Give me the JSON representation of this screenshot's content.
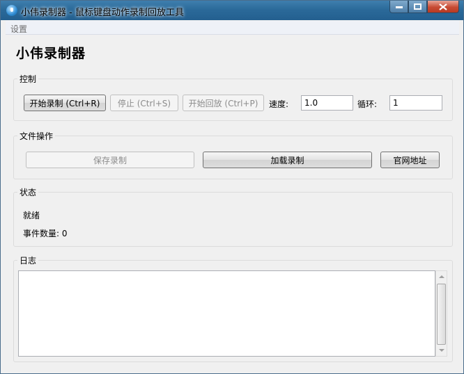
{
  "window": {
    "title": "小伟录制器 - 鼠标键盘动作录制回放工具"
  },
  "menu": {
    "items": [
      "设置"
    ]
  },
  "main": {
    "title": "小伟录制器"
  },
  "control": {
    "group_label": "控制",
    "start_record_label": "开始录制 (Ctrl+R)",
    "stop_label": "停止 (Ctrl+S)",
    "start_playback_label": "开始回放 (Ctrl+P)",
    "speed_label": "速度:",
    "speed_value": "1.0",
    "loop_label": "循环:",
    "loop_value": "1"
  },
  "file_ops": {
    "group_label": "文件操作",
    "save_label": "保存录制",
    "load_label": "加载录制",
    "website_label": "官网地址"
  },
  "status": {
    "group_label": "状态",
    "state_text": "就绪",
    "event_count_text": "事件数量: 0"
  },
  "log": {
    "group_label": "日志",
    "content": ""
  }
}
